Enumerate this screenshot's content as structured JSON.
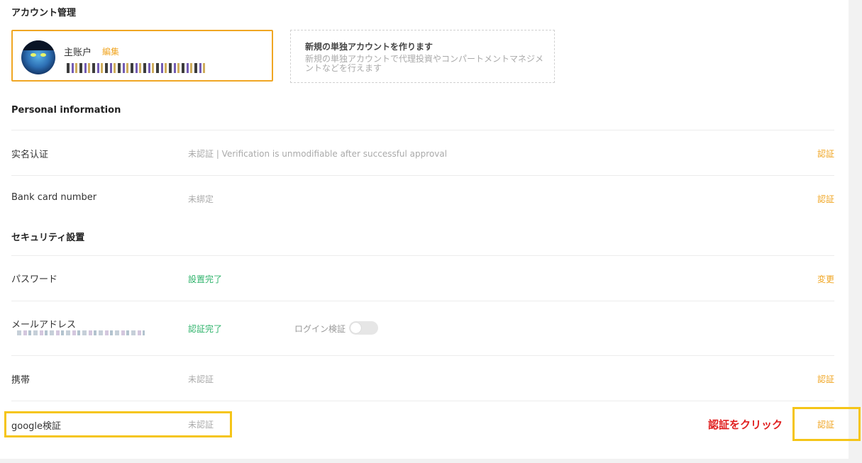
{
  "account_management": {
    "title": "アカウント管理",
    "main_account": {
      "label": "主账户",
      "edit_label": "編集"
    },
    "sub_account": {
      "title": "新規の単独アカウントを作ります",
      "description": "新規の単独アカウントで代理投資やコンパートメントマネジメントなどを行えます"
    }
  },
  "personal_info": {
    "title": "Personal information",
    "rows": [
      {
        "label": "实名认证",
        "status": "未認証 | Verification is unmodifiable after successful approval",
        "action": "認証"
      },
      {
        "label": "Bank card number",
        "status": "未綁定",
        "action": "認証"
      }
    ]
  },
  "security": {
    "title": "セキュリティ設置",
    "rows": [
      {
        "label": "パスワード",
        "status": "設置完了",
        "action": "変更"
      },
      {
        "label": "メールアドレス",
        "status": "認証完了",
        "login_verify_label": "ログイン検証"
      },
      {
        "label": "携帯",
        "status": "未認証",
        "action": "認証"
      },
      {
        "label": "google検証",
        "status": "未認証",
        "action": "認証"
      }
    ]
  },
  "annotation": {
    "callout": "認証をクリック",
    "highlight_color": "#f5c518",
    "callout_color": "#e02020"
  },
  "colors": {
    "accent": "#f0a623",
    "success": "#2fb36b",
    "muted": "#aaaaaa"
  },
  "toggle_login_verify_on": false
}
